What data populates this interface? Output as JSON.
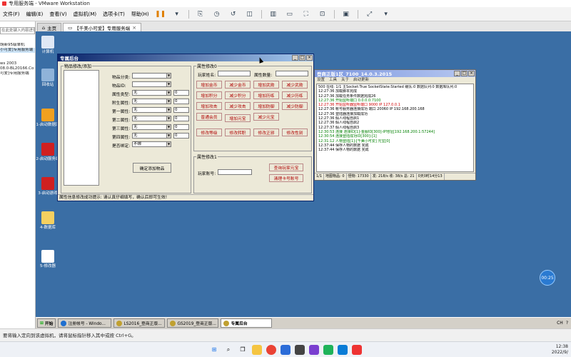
{
  "vmware": {
    "title": "专用服务端 - VMware Workstation",
    "menu": [
      "文件(F)",
      "编辑(E)",
      "查看(V)",
      "虚拟机(M)",
      "选项卡(T)",
      "帮助(H)"
    ],
    "status_text": "要将输入定向到该虚拟机，请将鼠标指针移入其中或按 Ctrl+G。"
  },
  "library": {
    "search_placeholder": "在此处键入内容进行搜索",
    "items": [
      "胡新95级单机",
      "小可爱]专用服务端",
      "",
      "ws 2003",
      "08.0-BL20166.Co",
      "可爱]专用服务端"
    ]
  },
  "tabs": [
    {
      "label": "主页"
    },
    {
      "label": "【千美小可爱】专用服务端",
      "close": "×"
    }
  ],
  "desktop_icons": [
    {
      "label": "计算机",
      "color": "#dfe8f5"
    },
    {
      "label": "回收站",
      "color": "#8fb3d9"
    },
    {
      "label": "1-启动数据库",
      "color": "#f0a020"
    },
    {
      "label": "2-启动服务端",
      "color": "#d02020"
    },
    {
      "label": "3-启动游戏",
      "color": "#d02020"
    },
    {
      "label": "4-数据库",
      "color": "#f5d060"
    },
    {
      "label": "5-修改器",
      "color": "#ffffff"
    }
  ],
  "clock_badge": "00:25",
  "win1": {
    "title": "专属后台",
    "group_add": "物品修改/添加",
    "item_category_label": "物品分类:",
    "item_id_label": "物品ID:",
    "attr_type_label": "属性类型:",
    "attr1_label": "附生属性:",
    "attr2_label": "第一属性:",
    "attr3_label": "第二属性:",
    "attr4_label": "第三属性:",
    "attr5_label": "第四属性:",
    "bind_label": "是否绑定:",
    "none_value": "无",
    "bind_value": "不绑",
    "num_value": "0",
    "confirm_add": "确定添加物品",
    "group_attr0": "属性修改0",
    "player_name_label": "玩家姓名:",
    "attr_qty_label": "属性数量:",
    "buttons_row1": [
      "增加金币",
      "减少金币",
      "增加武勋",
      "减少武勋"
    ],
    "buttons_row2": [
      "增加积分",
      "减少积分",
      "增加历练",
      "减少历练"
    ],
    "buttons_row3": [
      "增加攻击",
      "减少攻击",
      "增加防御",
      "减少防御"
    ],
    "buttons_row4": [
      "普通会员",
      "增加元宝",
      "减少元宝"
    ],
    "buttons_row5": [
      "修改等级",
      "修改转职",
      "修改正邪",
      "修改性别"
    ],
    "group_attr1": "属性修改1",
    "player_acct_label": "玩家账号:",
    "query_yuanbao": "查询玩家元宝",
    "clear_card": "清理卡号账号",
    "status": "属性信息修改成功提示: 请认真仔细填写，确认后即可生效!"
  },
  "win2": {
    "title": "登商正版1区_7100_14.0.3.2015",
    "menu": [
      "设置",
      "工具",
      "关于",
      "启动更新"
    ],
    "lines": [
      {
        "t": "500 在线: 1/1 主Socket:True SocketState:Started 缓队:0 数据队列:0 数据库队列:0",
        "c": "#000"
      },
      {
        "t": "12:27:36 加载脚本完成",
        "c": "#000"
      },
      {
        "t": "12:27:36 加载任务条件数据完成26",
        "c": "#000"
      },
      {
        "t": "12:27:36 开始监听端口 0.0.0.0:7100",
        "c": "#008000"
      },
      {
        "t": "12:27:36 开始监听器监听端口 9000 IP 127.0.0.1",
        "c": "#d00000"
      },
      {
        "t": "12:27:36 帐号服务器连接成功 端口 20060 IP 192.168.200.168",
        "c": "#000"
      },
      {
        "t": "12:27:36 登陆器连接加载成功",
        "c": "#000"
      },
      {
        "t": "12:27:36 假人线程自启1",
        "c": "#000"
      },
      {
        "t": "12:27:36 假人线程自启2",
        "c": "#000"
      },
      {
        "t": "12:27:37 假人线程自启3",
        "c": "#000"
      },
      {
        "t": "12:30:53 连接 连接ID[1]-金服ID[300]-IP地址[192.168.200.1:57244]",
        "c": "#008000"
      },
      {
        "t": "12:30:54 连接登陆成功ID[300]-[1]",
        "c": "#008000"
      },
      {
        "t": "12:31:12 人物登陆[1]-[千美小可爱] 元宝[0]",
        "c": "#008000"
      },
      {
        "t": "12:37:44 保存人物的数据 完成",
        "c": "#000"
      },
      {
        "t": "12:37:44 保存人物的数据 完成",
        "c": "#000"
      }
    ],
    "status": [
      "1/1",
      "地图物品: 0",
      "怪物: 17330",
      "发: 218/s 收: 38/s 总: 21",
      "0天0时14分13"
    ]
  },
  "guest_taskbar": {
    "start": "开始",
    "items": [
      {
        "label": "注册帐号 - Windo..."
      },
      {
        "label": "LS2016_登商正版..."
      },
      {
        "label": "GS2019_登商正版..."
      },
      {
        "label": "专属后台"
      }
    ],
    "tray": [
      "CH",
      "?"
    ]
  },
  "host_tray": {
    "time": "12:38",
    "date": "2022/9/"
  }
}
